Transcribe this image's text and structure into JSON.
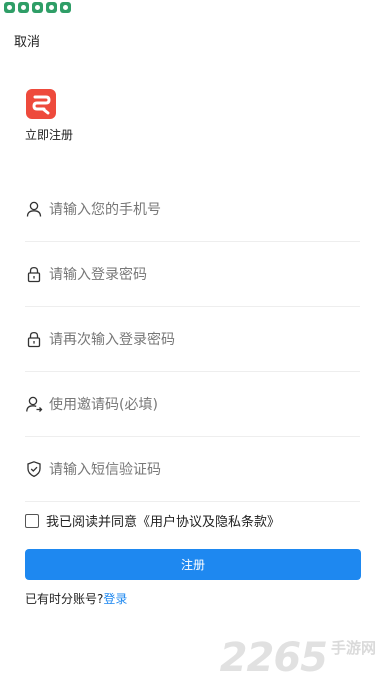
{
  "status_bar": {
    "icons": [
      "app-notification-icon",
      "app-notification-icon",
      "app-notification-icon",
      "app-notification-icon",
      "app-notification-icon"
    ]
  },
  "header": {
    "cancel_label": "取消"
  },
  "brand": {
    "logo_icon": "brand-logo-icon",
    "logo_color": "#ee4a3c",
    "title": "立即注册"
  },
  "form": {
    "fields": [
      {
        "icon": "user-icon",
        "placeholder": "请输入您的手机号"
      },
      {
        "icon": "lock-icon",
        "placeholder": "请输入登录密码"
      },
      {
        "icon": "lock-icon",
        "placeholder": "请再次输入登录密码"
      },
      {
        "icon": "user-share-icon",
        "placeholder": "使用邀请码(必填)"
      },
      {
        "icon": "shield-check-icon",
        "placeholder": "请输入短信验证码"
      }
    ],
    "agree_text": "我已阅读并同意《用户协议及隐私条款》",
    "submit_label": "注册",
    "login_prompt": "已有时分账号?",
    "login_link": "登录"
  },
  "colors": {
    "accent": "#1e88f0",
    "divider": "#eeeeee"
  },
  "watermark": {
    "number": "2265",
    "text": "手游网"
  }
}
